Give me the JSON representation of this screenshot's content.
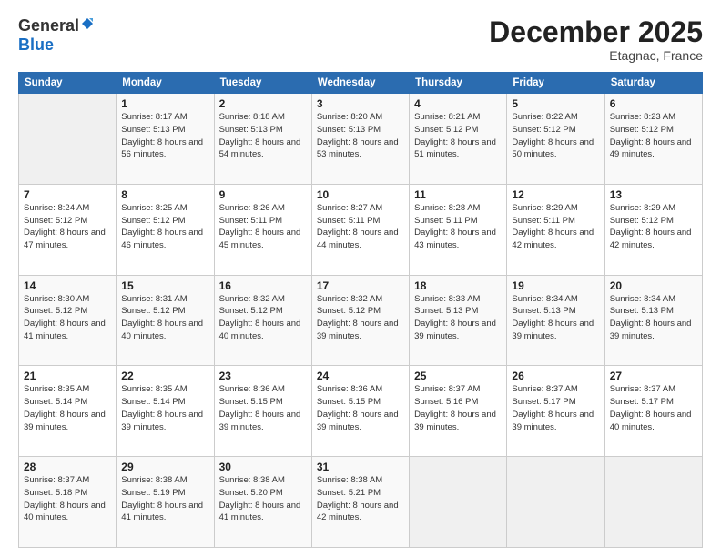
{
  "header": {
    "logo_general": "General",
    "logo_blue": "Blue",
    "month_title": "December 2025",
    "location": "Etagnac, France"
  },
  "weekdays": [
    "Sunday",
    "Monday",
    "Tuesday",
    "Wednesday",
    "Thursday",
    "Friday",
    "Saturday"
  ],
  "weeks": [
    [
      {
        "day": "",
        "sunrise": "",
        "sunset": "",
        "daylight": ""
      },
      {
        "day": "1",
        "sunrise": "Sunrise: 8:17 AM",
        "sunset": "Sunset: 5:13 PM",
        "daylight": "Daylight: 8 hours and 56 minutes."
      },
      {
        "day": "2",
        "sunrise": "Sunrise: 8:18 AM",
        "sunset": "Sunset: 5:13 PM",
        "daylight": "Daylight: 8 hours and 54 minutes."
      },
      {
        "day": "3",
        "sunrise": "Sunrise: 8:20 AM",
        "sunset": "Sunset: 5:13 PM",
        "daylight": "Daylight: 8 hours and 53 minutes."
      },
      {
        "day": "4",
        "sunrise": "Sunrise: 8:21 AM",
        "sunset": "Sunset: 5:12 PM",
        "daylight": "Daylight: 8 hours and 51 minutes."
      },
      {
        "day": "5",
        "sunrise": "Sunrise: 8:22 AM",
        "sunset": "Sunset: 5:12 PM",
        "daylight": "Daylight: 8 hours and 50 minutes."
      },
      {
        "day": "6",
        "sunrise": "Sunrise: 8:23 AM",
        "sunset": "Sunset: 5:12 PM",
        "daylight": "Daylight: 8 hours and 49 minutes."
      }
    ],
    [
      {
        "day": "7",
        "sunrise": "Sunrise: 8:24 AM",
        "sunset": "Sunset: 5:12 PM",
        "daylight": "Daylight: 8 hours and 47 minutes."
      },
      {
        "day": "8",
        "sunrise": "Sunrise: 8:25 AM",
        "sunset": "Sunset: 5:12 PM",
        "daylight": "Daylight: 8 hours and 46 minutes."
      },
      {
        "day": "9",
        "sunrise": "Sunrise: 8:26 AM",
        "sunset": "Sunset: 5:11 PM",
        "daylight": "Daylight: 8 hours and 45 minutes."
      },
      {
        "day": "10",
        "sunrise": "Sunrise: 8:27 AM",
        "sunset": "Sunset: 5:11 PM",
        "daylight": "Daylight: 8 hours and 44 minutes."
      },
      {
        "day": "11",
        "sunrise": "Sunrise: 8:28 AM",
        "sunset": "Sunset: 5:11 PM",
        "daylight": "Daylight: 8 hours and 43 minutes."
      },
      {
        "day": "12",
        "sunrise": "Sunrise: 8:29 AM",
        "sunset": "Sunset: 5:11 PM",
        "daylight": "Daylight: 8 hours and 42 minutes."
      },
      {
        "day": "13",
        "sunrise": "Sunrise: 8:29 AM",
        "sunset": "Sunset: 5:12 PM",
        "daylight": "Daylight: 8 hours and 42 minutes."
      }
    ],
    [
      {
        "day": "14",
        "sunrise": "Sunrise: 8:30 AM",
        "sunset": "Sunset: 5:12 PM",
        "daylight": "Daylight: 8 hours and 41 minutes."
      },
      {
        "day": "15",
        "sunrise": "Sunrise: 8:31 AM",
        "sunset": "Sunset: 5:12 PM",
        "daylight": "Daylight: 8 hours and 40 minutes."
      },
      {
        "day": "16",
        "sunrise": "Sunrise: 8:32 AM",
        "sunset": "Sunset: 5:12 PM",
        "daylight": "Daylight: 8 hours and 40 minutes."
      },
      {
        "day": "17",
        "sunrise": "Sunrise: 8:32 AM",
        "sunset": "Sunset: 5:12 PM",
        "daylight": "Daylight: 8 hours and 39 minutes."
      },
      {
        "day": "18",
        "sunrise": "Sunrise: 8:33 AM",
        "sunset": "Sunset: 5:13 PM",
        "daylight": "Daylight: 8 hours and 39 minutes."
      },
      {
        "day": "19",
        "sunrise": "Sunrise: 8:34 AM",
        "sunset": "Sunset: 5:13 PM",
        "daylight": "Daylight: 8 hours and 39 minutes."
      },
      {
        "day": "20",
        "sunrise": "Sunrise: 8:34 AM",
        "sunset": "Sunset: 5:13 PM",
        "daylight": "Daylight: 8 hours and 39 minutes."
      }
    ],
    [
      {
        "day": "21",
        "sunrise": "Sunrise: 8:35 AM",
        "sunset": "Sunset: 5:14 PM",
        "daylight": "Daylight: 8 hours and 39 minutes."
      },
      {
        "day": "22",
        "sunrise": "Sunrise: 8:35 AM",
        "sunset": "Sunset: 5:14 PM",
        "daylight": "Daylight: 8 hours and 39 minutes."
      },
      {
        "day": "23",
        "sunrise": "Sunrise: 8:36 AM",
        "sunset": "Sunset: 5:15 PM",
        "daylight": "Daylight: 8 hours and 39 minutes."
      },
      {
        "day": "24",
        "sunrise": "Sunrise: 8:36 AM",
        "sunset": "Sunset: 5:15 PM",
        "daylight": "Daylight: 8 hours and 39 minutes."
      },
      {
        "day": "25",
        "sunrise": "Sunrise: 8:37 AM",
        "sunset": "Sunset: 5:16 PM",
        "daylight": "Daylight: 8 hours and 39 minutes."
      },
      {
        "day": "26",
        "sunrise": "Sunrise: 8:37 AM",
        "sunset": "Sunset: 5:17 PM",
        "daylight": "Daylight: 8 hours and 39 minutes."
      },
      {
        "day": "27",
        "sunrise": "Sunrise: 8:37 AM",
        "sunset": "Sunset: 5:17 PM",
        "daylight": "Daylight: 8 hours and 40 minutes."
      }
    ],
    [
      {
        "day": "28",
        "sunrise": "Sunrise: 8:37 AM",
        "sunset": "Sunset: 5:18 PM",
        "daylight": "Daylight: 8 hours and 40 minutes."
      },
      {
        "day": "29",
        "sunrise": "Sunrise: 8:38 AM",
        "sunset": "Sunset: 5:19 PM",
        "daylight": "Daylight: 8 hours and 41 minutes."
      },
      {
        "day": "30",
        "sunrise": "Sunrise: 8:38 AM",
        "sunset": "Sunset: 5:20 PM",
        "daylight": "Daylight: 8 hours and 41 minutes."
      },
      {
        "day": "31",
        "sunrise": "Sunrise: 8:38 AM",
        "sunset": "Sunset: 5:21 PM",
        "daylight": "Daylight: 8 hours and 42 minutes."
      },
      {
        "day": "",
        "sunrise": "",
        "sunset": "",
        "daylight": ""
      },
      {
        "day": "",
        "sunrise": "",
        "sunset": "",
        "daylight": ""
      },
      {
        "day": "",
        "sunrise": "",
        "sunset": "",
        "daylight": ""
      }
    ]
  ]
}
